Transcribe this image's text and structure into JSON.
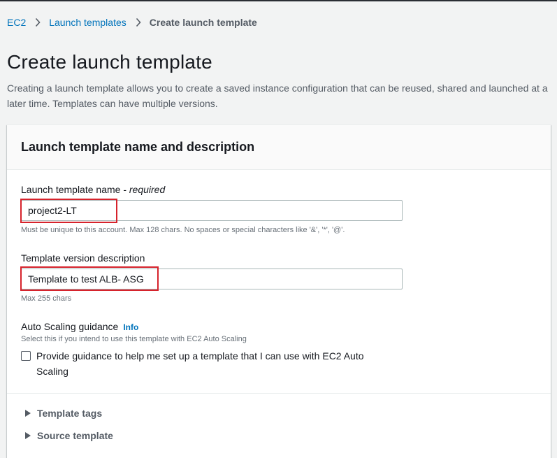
{
  "breadcrumb": {
    "items": [
      "EC2",
      "Launch templates"
    ],
    "current": "Create launch template"
  },
  "page": {
    "title": "Create launch template",
    "description": "Creating a launch template allows you to create a saved instance configuration that can be reused, shared and launched at a later time. Templates can have multiple versions."
  },
  "panel": {
    "title": "Launch template name and description",
    "name_field": {
      "label": "Launch template name - ",
      "required": "required",
      "value": "project2-LT",
      "hint": "Must be unique to this account. Max 128 chars. No spaces or special characters like '&', '*', '@'."
    },
    "desc_field": {
      "label": "Template version description",
      "value": "Template to test ALB- ASG",
      "hint": "Max 255 chars"
    },
    "asg": {
      "label": "Auto Scaling guidance",
      "info": "Info",
      "hint": "Select this if you intend to use this template with EC2 Auto Scaling",
      "checkbox_label": "Provide guidance to help me set up a template that I can use with EC2 Auto Scaling",
      "checked": false
    },
    "expanders": [
      "Template tags",
      "Source template"
    ]
  },
  "colors": {
    "link": "#0073bb",
    "highlight": "#d6232c",
    "background": "#f2f3f3"
  }
}
